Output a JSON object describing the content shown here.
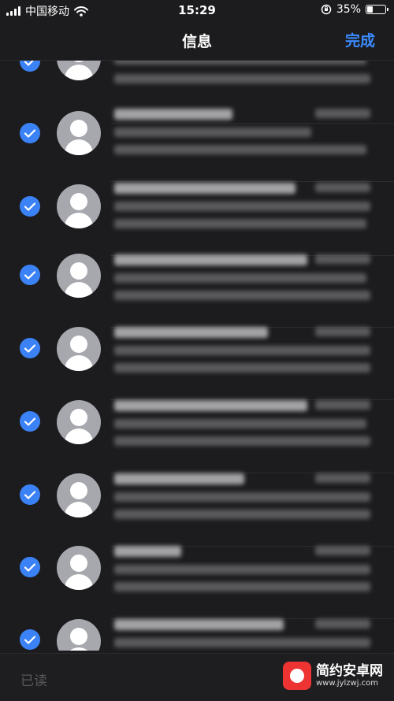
{
  "status_bar": {
    "carrier": "中国移动",
    "time": "15:29",
    "battery_percent": "35%",
    "battery_level": 0.35
  },
  "nav": {
    "title": "信息",
    "done_label": "完成"
  },
  "messages": [
    {
      "selected": true
    },
    {
      "selected": true
    },
    {
      "selected": true
    },
    {
      "selected": true
    },
    {
      "selected": true
    },
    {
      "selected": true
    },
    {
      "selected": true
    },
    {
      "selected": true
    },
    {
      "selected": true
    }
  ],
  "bottom_bar": {
    "read_label": "已读"
  },
  "watermark": {
    "name_cn": "简约安卓网",
    "url": "www.jylzwj.com"
  },
  "colors": {
    "accent": "#3b8bff",
    "check": "#3b82f6",
    "background": "#1c1c1e"
  }
}
